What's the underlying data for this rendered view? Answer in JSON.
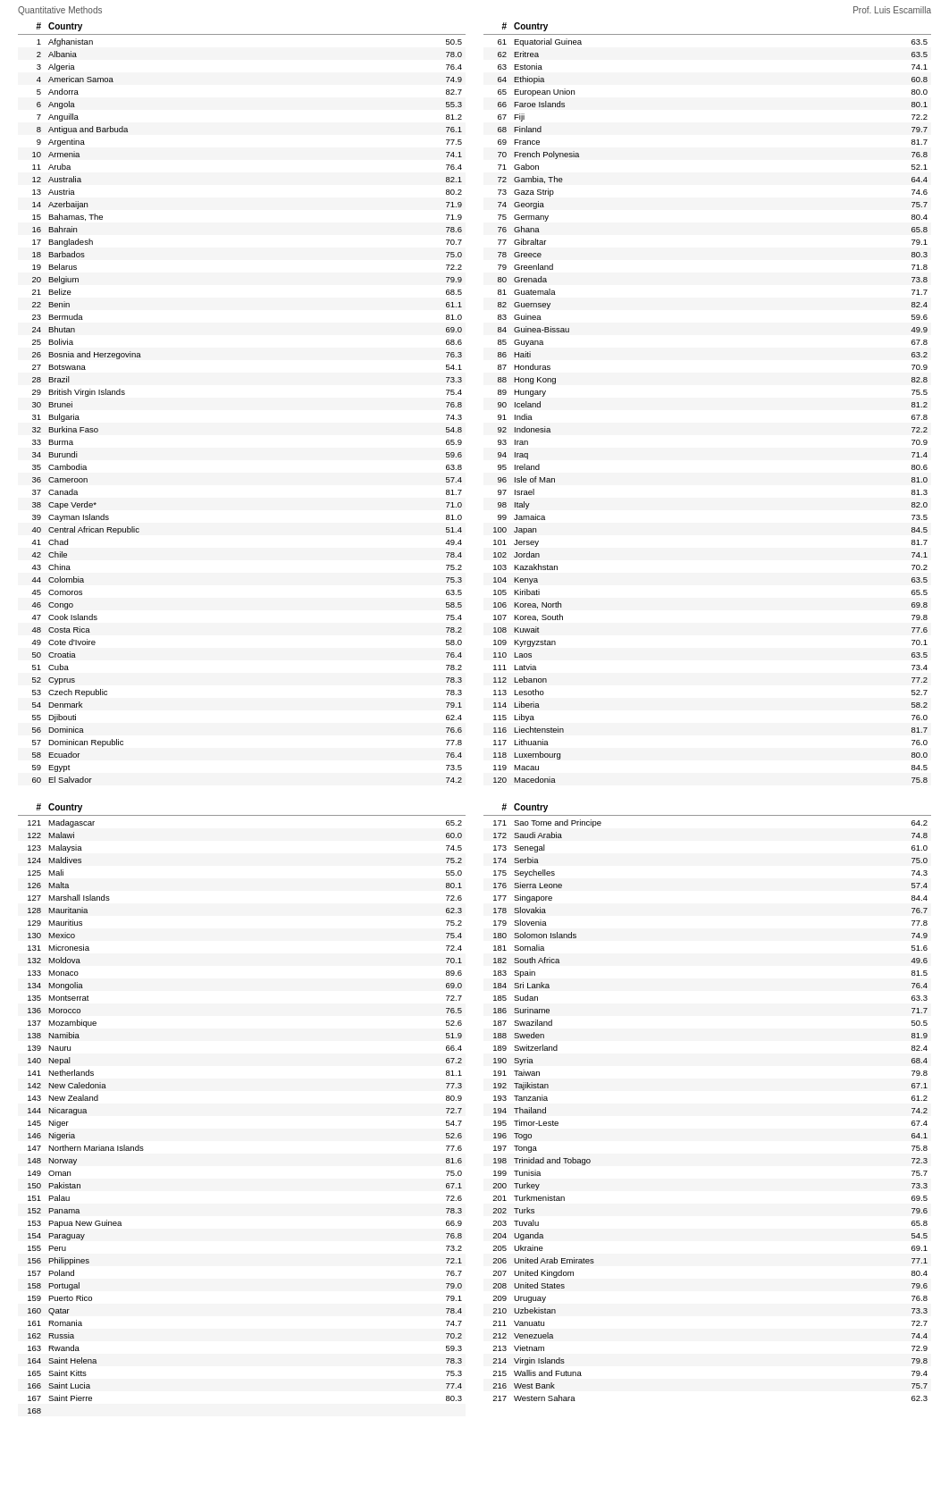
{
  "header": {
    "left": "Quantitative Methods",
    "right": "Prof. Luis Escamilla"
  },
  "tableHeaders": [
    "#",
    "Country",
    "",
    "#",
    "Country",
    ""
  ],
  "col1Label": "#",
  "col2Label": "Country",
  "col3Label": "",
  "col4Label": "#",
  "col5Label": "Country",
  "col6Label": "",
  "section1Left": [
    {
      "num": "1",
      "country": "Afghanistan",
      "score": "50.5"
    },
    {
      "num": "2",
      "country": "Albania",
      "score": "78.0"
    },
    {
      "num": "3",
      "country": "Algeria",
      "score": "76.4"
    },
    {
      "num": "4",
      "country": "American Samoa",
      "score": "74.9"
    },
    {
      "num": "5",
      "country": "Andorra",
      "score": "82.7"
    },
    {
      "num": "6",
      "country": "Angola",
      "score": "55.3"
    },
    {
      "num": "7",
      "country": "Anguilla",
      "score": "81.2"
    },
    {
      "num": "8",
      "country": "Antigua and Barbuda",
      "score": "76.1"
    },
    {
      "num": "9",
      "country": "Argentina",
      "score": "77.5"
    },
    {
      "num": "10",
      "country": "Armenia",
      "score": "74.1"
    },
    {
      "num": "11",
      "country": "Aruba",
      "score": "76.4"
    },
    {
      "num": "12",
      "country": "Australia",
      "score": "82.1"
    },
    {
      "num": "13",
      "country": "Austria",
      "score": "80.2"
    },
    {
      "num": "14",
      "country": "Azerbaijan",
      "score": "71.9"
    },
    {
      "num": "15",
      "country": "Bahamas, The",
      "score": "71.9"
    },
    {
      "num": "16",
      "country": "Bahrain",
      "score": "78.6"
    },
    {
      "num": "17",
      "country": "Bangladesh",
      "score": "70.7"
    },
    {
      "num": "18",
      "country": "Barbados",
      "score": "75.0"
    },
    {
      "num": "19",
      "country": "Belarus",
      "score": "72.2"
    },
    {
      "num": "20",
      "country": "Belgium",
      "score": "79.9"
    },
    {
      "num": "21",
      "country": "Belize",
      "score": "68.5"
    },
    {
      "num": "22",
      "country": "Benin",
      "score": "61.1"
    },
    {
      "num": "23",
      "country": "Bermuda",
      "score": "81.0"
    },
    {
      "num": "24",
      "country": "Bhutan",
      "score": "69.0"
    },
    {
      "num": "25",
      "country": "Bolivia",
      "score": "68.6"
    },
    {
      "num": "26",
      "country": "Bosnia and Herzegovina",
      "score": "76.3"
    },
    {
      "num": "27",
      "country": "Botswana",
      "score": "54.1"
    },
    {
      "num": "28",
      "country": "Brazil",
      "score": "73.3"
    },
    {
      "num": "29",
      "country": "British Virgin Islands",
      "score": "75.4"
    },
    {
      "num": "30",
      "country": "Brunei",
      "score": "76.8"
    },
    {
      "num": "31",
      "country": "Bulgaria",
      "score": "74.3"
    },
    {
      "num": "32",
      "country": "Burkina Faso",
      "score": "54.8"
    },
    {
      "num": "33",
      "country": "Burma",
      "score": "65.9"
    },
    {
      "num": "34",
      "country": "Burundi",
      "score": "59.6"
    },
    {
      "num": "35",
      "country": "Cambodia",
      "score": "63.8"
    },
    {
      "num": "36",
      "country": "Cameroon",
      "score": "57.4"
    },
    {
      "num": "37",
      "country": "Canada",
      "score": "81.7"
    },
    {
      "num": "38",
      "country": "Cape Verde*",
      "score": "71.0"
    },
    {
      "num": "39",
      "country": "Cayman Islands",
      "score": "81.0"
    },
    {
      "num": "40",
      "country": "Central African Republic",
      "score": "51.4"
    },
    {
      "num": "41",
      "country": "Chad",
      "score": "49.4"
    },
    {
      "num": "42",
      "country": "Chile",
      "score": "78.4"
    },
    {
      "num": "43",
      "country": "China",
      "score": "75.2"
    },
    {
      "num": "44",
      "country": "Colombia",
      "score": "75.3"
    },
    {
      "num": "45",
      "country": "Comoros",
      "score": "63.5"
    },
    {
      "num": "46",
      "country": "Congo",
      "score": "58.5"
    },
    {
      "num": "47",
      "country": "Cook Islands",
      "score": "75.4"
    },
    {
      "num": "48",
      "country": "Costa Rica",
      "score": "78.2"
    },
    {
      "num": "49",
      "country": "Cote d'Ivoire",
      "score": "58.0"
    },
    {
      "num": "50",
      "country": "Croatia",
      "score": "76.4"
    },
    {
      "num": "51",
      "country": "Cuba",
      "score": "78.2"
    },
    {
      "num": "52",
      "country": "Cyprus",
      "score": "78.3"
    },
    {
      "num": "53",
      "country": "Czech Republic",
      "score": "78.3"
    },
    {
      "num": "54",
      "country": "Denmark",
      "score": "79.1"
    },
    {
      "num": "55",
      "country": "Djibouti",
      "score": "62.4"
    },
    {
      "num": "56",
      "country": "Dominica",
      "score": "76.6"
    },
    {
      "num": "57",
      "country": "Dominican Republic",
      "score": "77.8"
    },
    {
      "num": "58",
      "country": "Ecuador",
      "score": "76.4"
    },
    {
      "num": "59",
      "country": "Egypt",
      "score": "73.5"
    },
    {
      "num": "60",
      "country": "El Salvador",
      "score": "74.2"
    }
  ],
  "section1Right": [
    {
      "num": "61",
      "country": "Equatorial Guinea",
      "score": "63.5"
    },
    {
      "num": "62",
      "country": "Eritrea",
      "score": "63.5"
    },
    {
      "num": "63",
      "country": "Estonia",
      "score": "74.1"
    },
    {
      "num": "64",
      "country": "Ethiopia",
      "score": "60.8"
    },
    {
      "num": "65",
      "country": "European Union",
      "score": "80.0"
    },
    {
      "num": "66",
      "country": "Faroe Islands",
      "score": "80.1"
    },
    {
      "num": "67",
      "country": "Fiji",
      "score": "72.2"
    },
    {
      "num": "68",
      "country": "Finland",
      "score": "79.7"
    },
    {
      "num": "69",
      "country": "France",
      "score": "81.7"
    },
    {
      "num": "70",
      "country": "French Polynesia",
      "score": "76.8"
    },
    {
      "num": "71",
      "country": "Gabon",
      "score": "52.1"
    },
    {
      "num": "72",
      "country": "Gambia, The",
      "score": "64.4"
    },
    {
      "num": "73",
      "country": "Gaza Strip",
      "score": "74.6"
    },
    {
      "num": "74",
      "country": "Georgia",
      "score": "75.7"
    },
    {
      "num": "75",
      "country": "Germany",
      "score": "80.4"
    },
    {
      "num": "76",
      "country": "Ghana",
      "score": "65.8"
    },
    {
      "num": "77",
      "country": "Gibraltar",
      "score": "79.1"
    },
    {
      "num": "78",
      "country": "Greece",
      "score": "80.3"
    },
    {
      "num": "79",
      "country": "Greenland",
      "score": "71.8"
    },
    {
      "num": "80",
      "country": "Grenada",
      "score": "73.8"
    },
    {
      "num": "81",
      "country": "Guatemala",
      "score": "71.7"
    },
    {
      "num": "82",
      "country": "Guernsey",
      "score": "82.4"
    },
    {
      "num": "83",
      "country": "Guinea",
      "score": "59.6"
    },
    {
      "num": "84",
      "country": "Guinea-Bissau",
      "score": "49.9"
    },
    {
      "num": "85",
      "country": "Guyana",
      "score": "67.8"
    },
    {
      "num": "86",
      "country": "Haiti",
      "score": "63.2"
    },
    {
      "num": "87",
      "country": "Honduras",
      "score": "70.9"
    },
    {
      "num": "88",
      "country": "Hong Kong",
      "score": "82.8"
    },
    {
      "num": "89",
      "country": "Hungary",
      "score": "75.5"
    },
    {
      "num": "90",
      "country": "Iceland",
      "score": "81.2"
    },
    {
      "num": "91",
      "country": "India",
      "score": "67.8"
    },
    {
      "num": "92",
      "country": "Indonesia",
      "score": "72.2"
    },
    {
      "num": "93",
      "country": "Iran",
      "score": "70.9"
    },
    {
      "num": "94",
      "country": "Iraq",
      "score": "71.4"
    },
    {
      "num": "95",
      "country": "Ireland",
      "score": "80.6"
    },
    {
      "num": "96",
      "country": "Isle of Man",
      "score": "81.0"
    },
    {
      "num": "97",
      "country": "Israel",
      "score": "81.3"
    },
    {
      "num": "98",
      "country": "Italy",
      "score": "82.0"
    },
    {
      "num": "99",
      "country": "Jamaica",
      "score": "73.5"
    },
    {
      "num": "100",
      "country": "Japan",
      "score": "84.5"
    },
    {
      "num": "101",
      "country": "Jersey",
      "score": "81.7"
    },
    {
      "num": "102",
      "country": "Jordan",
      "score": "74.1"
    },
    {
      "num": "103",
      "country": "Kazakhstan",
      "score": "70.2"
    },
    {
      "num": "104",
      "country": "Kenya",
      "score": "63.5"
    },
    {
      "num": "105",
      "country": "Kiribati",
      "score": "65.5"
    },
    {
      "num": "106",
      "country": "Korea, North",
      "score": "69.8"
    },
    {
      "num": "107",
      "country": "Korea, South",
      "score": "79.8"
    },
    {
      "num": "108",
      "country": "Kuwait",
      "score": "77.6"
    },
    {
      "num": "109",
      "country": "Kyrgyzstan",
      "score": "70.1"
    },
    {
      "num": "110",
      "country": "Laos",
      "score": "63.5"
    },
    {
      "num": "111",
      "country": "Latvia",
      "score": "73.4"
    },
    {
      "num": "112",
      "country": "Lebanon",
      "score": "77.2"
    },
    {
      "num": "113",
      "country": "Lesotho",
      "score": "52.7"
    },
    {
      "num": "114",
      "country": "Liberia",
      "score": "58.2"
    },
    {
      "num": "115",
      "country": "Libya",
      "score": "76.0"
    },
    {
      "num": "116",
      "country": "Liechtenstein",
      "score": "81.7"
    },
    {
      "num": "117",
      "country": "Lithuania",
      "score": "76.0"
    },
    {
      "num": "118",
      "country": "Luxembourg",
      "score": "80.0"
    },
    {
      "num": "119",
      "country": "Macau",
      "score": "84.5"
    },
    {
      "num": "120",
      "country": "Macedonia",
      "score": "75.8"
    }
  ],
  "section2Left": [
    {
      "num": "121",
      "country": "Madagascar",
      "score": "65.2"
    },
    {
      "num": "122",
      "country": "Malawi",
      "score": "60.0"
    },
    {
      "num": "123",
      "country": "Malaysia",
      "score": "74.5"
    },
    {
      "num": "124",
      "country": "Maldives",
      "score": "75.2"
    },
    {
      "num": "125",
      "country": "Mali",
      "score": "55.0"
    },
    {
      "num": "126",
      "country": "Malta",
      "score": "80.1"
    },
    {
      "num": "127",
      "country": "Marshall Islands",
      "score": "72.6"
    },
    {
      "num": "128",
      "country": "Mauritania",
      "score": "62.3"
    },
    {
      "num": "129",
      "country": "Mauritius",
      "score": "75.2"
    },
    {
      "num": "130",
      "country": "Mexico",
      "score": "75.4"
    },
    {
      "num": "131",
      "country": "Micronesia",
      "score": "72.4"
    },
    {
      "num": "132",
      "country": "Moldova",
      "score": "70.1"
    },
    {
      "num": "133",
      "country": "Monaco",
      "score": "89.6"
    },
    {
      "num": "134",
      "country": "Mongolia",
      "score": "69.0"
    },
    {
      "num": "135",
      "country": "Montserrat",
      "score": "72.7"
    },
    {
      "num": "136",
      "country": "Morocco",
      "score": "76.5"
    },
    {
      "num": "137",
      "country": "Mozambique",
      "score": "52.6"
    },
    {
      "num": "138",
      "country": "Namibia",
      "score": "51.9"
    },
    {
      "num": "139",
      "country": "Nauru",
      "score": "66.4"
    },
    {
      "num": "140",
      "country": "Nepal",
      "score": "67.2"
    },
    {
      "num": "141",
      "country": "Netherlands",
      "score": "81.1"
    },
    {
      "num": "142",
      "country": "New Caledonia",
      "score": "77.3"
    },
    {
      "num": "143",
      "country": "New Zealand",
      "score": "80.9"
    },
    {
      "num": "144",
      "country": "Nicaragua",
      "score": "72.7"
    },
    {
      "num": "145",
      "country": "Niger",
      "score": "54.7"
    },
    {
      "num": "146",
      "country": "Nigeria",
      "score": "52.6"
    },
    {
      "num": "147",
      "country": "Northern Mariana Islands",
      "score": "77.6"
    },
    {
      "num": "148",
      "country": "Norway",
      "score": "81.6"
    },
    {
      "num": "149",
      "country": "Oman",
      "score": "75.0"
    },
    {
      "num": "150",
      "country": "Pakistan",
      "score": "67.1"
    },
    {
      "num": "151",
      "country": "Palau",
      "score": "72.6"
    },
    {
      "num": "152",
      "country": "Panama",
      "score": "78.3"
    },
    {
      "num": "153",
      "country": "Papua New Guinea",
      "score": "66.9"
    },
    {
      "num": "154",
      "country": "Paraguay",
      "score": "76.8"
    },
    {
      "num": "155",
      "country": "Peru",
      "score": "73.2"
    },
    {
      "num": "156",
      "country": "Philippines",
      "score": "72.1"
    },
    {
      "num": "157",
      "country": "Poland",
      "score": "76.7"
    },
    {
      "num": "158",
      "country": "Portugal",
      "score": "79.0"
    },
    {
      "num": "159",
      "country": "Puerto Rico",
      "score": "79.1"
    },
    {
      "num": "160",
      "country": "Qatar",
      "score": "78.4"
    },
    {
      "num": "161",
      "country": "Romania",
      "score": "74.7"
    },
    {
      "num": "162",
      "country": "Russia",
      "score": "70.2"
    },
    {
      "num": "163",
      "country": "Rwanda",
      "score": "59.3"
    },
    {
      "num": "164",
      "country": "Saint Helena",
      "score": "78.3"
    },
    {
      "num": "165",
      "country": "Saint Kitts",
      "score": "75.3"
    },
    {
      "num": "166",
      "country": "Saint Lucia",
      "score": "77.4"
    },
    {
      "num": "167",
      "country": "Saint Pierre",
      "score": "80.3"
    },
    {
      "num": "168",
      "country": "",
      "score": ""
    }
  ],
  "section2Right": [
    {
      "num": "171",
      "country": "Sao Tome and Principe",
      "score": "64.2"
    },
    {
      "num": "172",
      "country": "Saudi Arabia",
      "score": "74.8"
    },
    {
      "num": "173",
      "country": "Senegal",
      "score": "61.0"
    },
    {
      "num": "174",
      "country": "Serbia",
      "score": "75.0"
    },
    {
      "num": "175",
      "country": "Seychelles",
      "score": "74.3"
    },
    {
      "num": "176",
      "country": "Sierra Leone",
      "score": "57.4"
    },
    {
      "num": "177",
      "country": "Singapore",
      "score": "84.4"
    },
    {
      "num": "178",
      "country": "Slovakia",
      "score": "76.7"
    },
    {
      "num": "179",
      "country": "Slovenia",
      "score": "77.8"
    },
    {
      "num": "180",
      "country": "Solomon Islands",
      "score": "74.9"
    },
    {
      "num": "181",
      "country": "Somalia",
      "score": "51.6"
    },
    {
      "num": "182",
      "country": "South Africa",
      "score": "49.6"
    },
    {
      "num": "183",
      "country": "Spain",
      "score": "81.5"
    },
    {
      "num": "184",
      "country": "Sri Lanka",
      "score": "76.4"
    },
    {
      "num": "185",
      "country": "Sudan",
      "score": "63.3"
    },
    {
      "num": "186",
      "country": "Suriname",
      "score": "71.7"
    },
    {
      "num": "187",
      "country": "Swaziland",
      "score": "50.5"
    },
    {
      "num": "188",
      "country": "Sweden",
      "score": "81.9"
    },
    {
      "num": "189",
      "country": "Switzerland",
      "score": "82.4"
    },
    {
      "num": "190",
      "country": "Syria",
      "score": "68.4"
    },
    {
      "num": "191",
      "country": "Taiwan",
      "score": "79.8"
    },
    {
      "num": "192",
      "country": "Tajikistan",
      "score": "67.1"
    },
    {
      "num": "193",
      "country": "Tanzania",
      "score": "61.2"
    },
    {
      "num": "194",
      "country": "Thailand",
      "score": "74.2"
    },
    {
      "num": "195",
      "country": "Timor-Leste",
      "score": "67.4"
    },
    {
      "num": "196",
      "country": "Togo",
      "score": "64.1"
    },
    {
      "num": "197",
      "country": "Tonga",
      "score": "75.8"
    },
    {
      "num": "198",
      "country": "Trinidad and Tobago",
      "score": "72.3"
    },
    {
      "num": "199",
      "country": "Tunisia",
      "score": "75.7"
    },
    {
      "num": "200",
      "country": "Turkey",
      "score": "73.3"
    },
    {
      "num": "201",
      "country": "Turkmenistan",
      "score": "69.5"
    },
    {
      "num": "202",
      "country": "Turks",
      "score": "79.6"
    },
    {
      "num": "203",
      "country": "Tuvalu",
      "score": "65.8"
    },
    {
      "num": "204",
      "country": "Uganda",
      "score": "54.5"
    },
    {
      "num": "205",
      "country": "Ukraine",
      "score": "69.1"
    },
    {
      "num": "206",
      "country": "United Arab Emirates",
      "score": "77.1"
    },
    {
      "num": "207",
      "country": "United Kingdom",
      "score": "80.4"
    },
    {
      "num": "208",
      "country": "United States",
      "score": "79.6"
    },
    {
      "num": "209",
      "country": "Uruguay",
      "score": "76.8"
    },
    {
      "num": "210",
      "country": "Uzbekistan",
      "score": "73.3"
    },
    {
      "num": "211",
      "country": "Vanuatu",
      "score": "72.7"
    },
    {
      "num": "212",
      "country": "Venezuela",
      "score": "74.4"
    },
    {
      "num": "213",
      "country": "Vietnam",
      "score": "72.9"
    },
    {
      "num": "214",
      "country": "Virgin Islands",
      "score": "79.8"
    },
    {
      "num": "215",
      "country": "Wallis and Futuna",
      "score": "79.4"
    },
    {
      "num": "216",
      "country": "West Bank",
      "score": "75.7"
    },
    {
      "num": "217",
      "country": "Western Sahara",
      "score": "62.3"
    }
  ],
  "sectionHeader": {
    "num": "#",
    "country": "Country",
    "score": ""
  }
}
